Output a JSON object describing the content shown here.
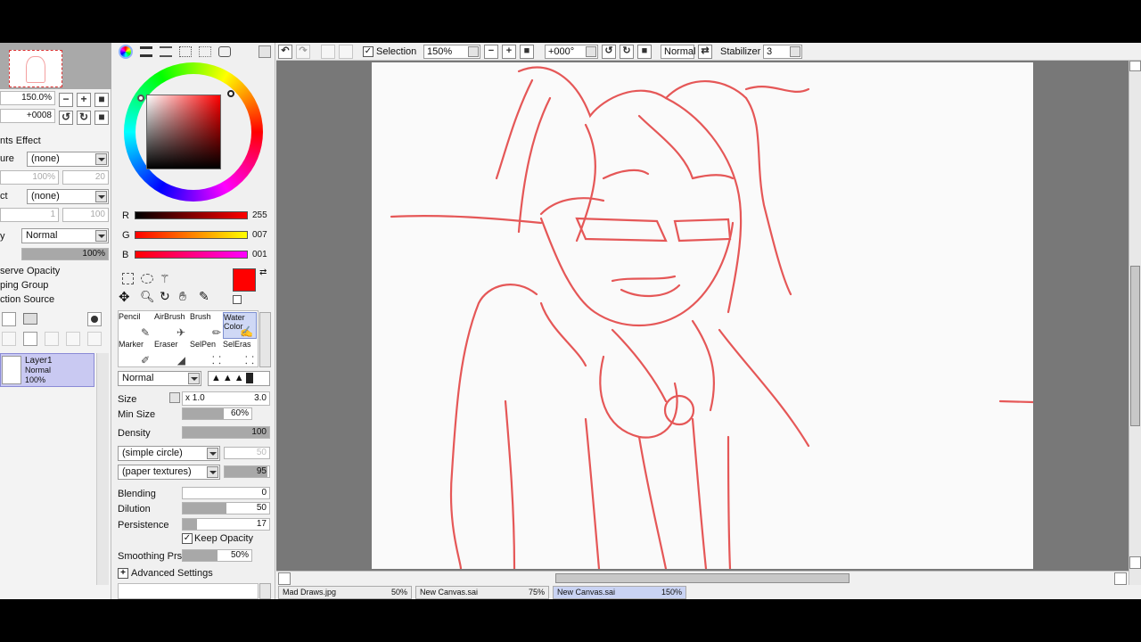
{
  "navigator": {
    "zoom_value": "150.0%",
    "rotate_value": "+0008",
    "zoom_minus": "−",
    "zoom_plus": "+"
  },
  "layer_panel": {
    "section_title": "nts Effect",
    "texture_label": "ure",
    "texture_value": "(none)",
    "texture_amount": "100%",
    "texture_scale": "20",
    "effect_label": "ct",
    "effect_value": "(none)",
    "effect_width": "1",
    "effect_strength": "100",
    "blend_mode": "Normal",
    "opacity": "100%",
    "opacity_fill": 1.0,
    "preserve_opacity_label": "serve Opacity",
    "clipping_group_label": "ping Group",
    "selection_source_label": "ction Source",
    "layers": [
      {
        "name": "Layer1",
        "mode": "Normal",
        "opacity": "100%"
      }
    ]
  },
  "color": {
    "current": "#ff0000",
    "r_label": "R",
    "r_value": "255",
    "g_label": "G",
    "g_value": "007",
    "b_label": "B",
    "b_value": "001"
  },
  "tools": {
    "row1": [
      {
        "label": "Pencil",
        "glyph": "✎"
      },
      {
        "label": "AirBrush",
        "glyph": "✈"
      },
      {
        "label": "Brush",
        "glyph": "✏"
      },
      {
        "label": "Water Color",
        "glyph": "✍"
      }
    ],
    "row2": [
      {
        "label": "Marker",
        "glyph": "✐"
      },
      {
        "label": "Eraser",
        "glyph": "◢"
      },
      {
        "label": "SelPen",
        "glyph": "⸬"
      },
      {
        "label": "SelEras",
        "glyph": "⸬"
      }
    ]
  },
  "brush": {
    "blend_mode": "Normal",
    "size_label": "Size",
    "size_mult": "x 1.0",
    "size_value": "3.0",
    "min_size_label": "Min Size",
    "min_size_value": "60%",
    "min_size_fill": 0.6,
    "density_label": "Density",
    "density_value": "100",
    "density_fill": 1.0,
    "shape": "(simple circle)",
    "shape_value": "50",
    "texture": "(paper textures)",
    "texture_value": "95",
    "texture_fill": 0.95,
    "blending_label": "Blending",
    "blending_value": "0",
    "blending_fill": 0.0,
    "dilution_label": "Dilution",
    "dilution_value": "50",
    "dilution_fill": 0.5,
    "persistence_label": "Persistence",
    "persistence_value": "17",
    "persistence_fill": 0.17,
    "keep_opacity_label": "Keep Opacity",
    "smoothing_label": "Smoothing Prs",
    "smoothing_value": "50%",
    "smoothing_fill": 0.5,
    "advanced_label": "Advanced Settings"
  },
  "toolbar": {
    "selection_label": "Selection",
    "zoom": "150%",
    "rotation": "+000°",
    "blend": "Normal",
    "stabilizer_label": "Stabilizer",
    "stabilizer_value": "3"
  },
  "tabs": [
    {
      "name": "Mad Draws.jpg",
      "zoom": "50%"
    },
    {
      "name": "New Canvas.sai",
      "zoom": "75%"
    },
    {
      "name": "New Canvas.sai",
      "zoom": "150%"
    }
  ]
}
